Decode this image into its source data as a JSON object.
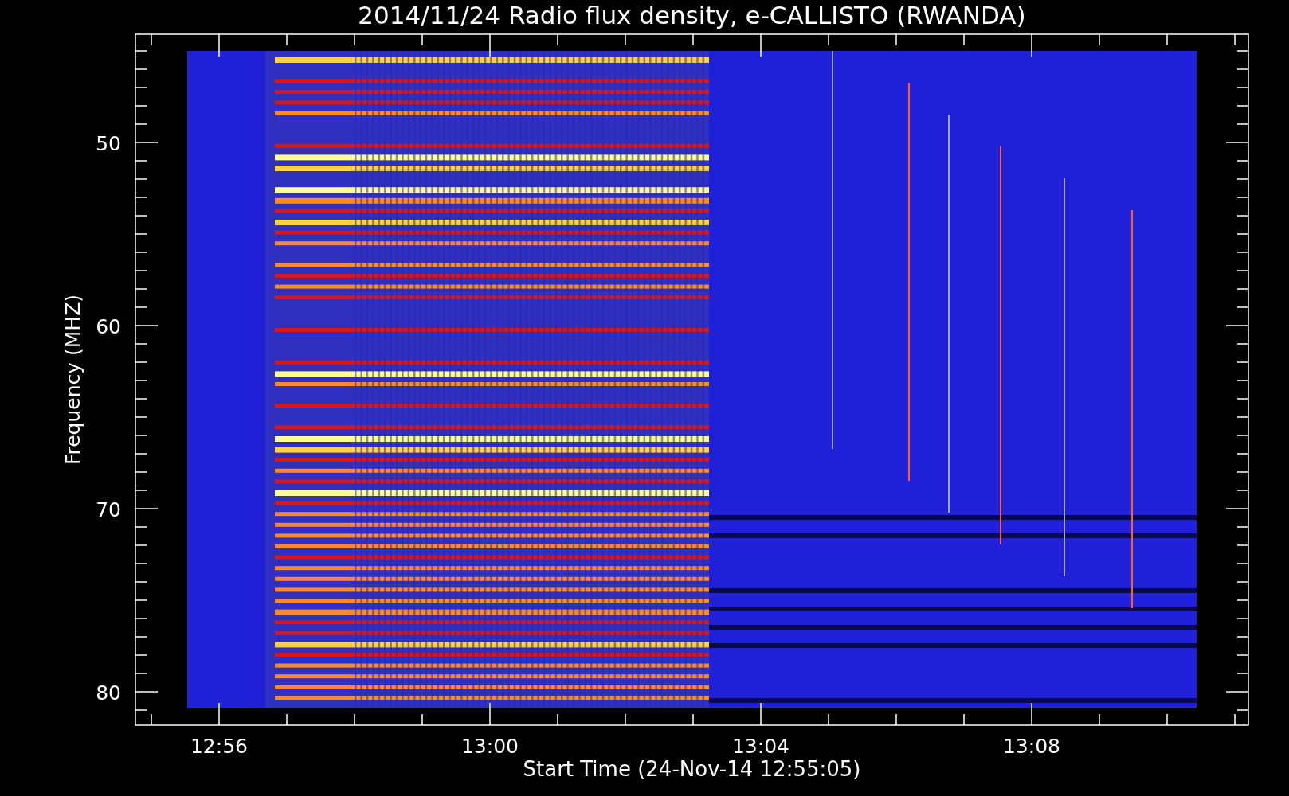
{
  "plot": {
    "title": "2014/11/24  Radio flux density, e-CALLISTO (RWANDA)",
    "ylabel": "Frequency (MHZ)",
    "xlabel": "Start Time (24-Nov-14 12:55:05)",
    "yticks": [
      "50",
      "60",
      "70",
      "80"
    ],
    "xticks": [
      "12:56",
      "13:00",
      "13:04",
      "13:08"
    ]
  }
}
